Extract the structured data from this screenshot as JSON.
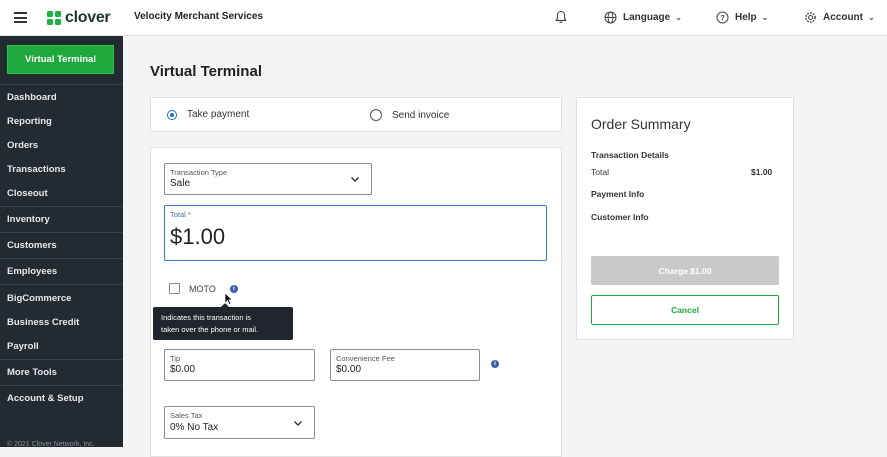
{
  "header": {
    "logo_text": "clover",
    "merchant_name": "Velocity Merchant Services",
    "language_label": "Language",
    "help_label": "Help",
    "account_label": "Account",
    "brand_color": "#1fa83c"
  },
  "sidebar": {
    "primary_button": "Virtual Terminal",
    "items": [
      {
        "label": "Dashboard"
      },
      {
        "label": "Reporting"
      },
      {
        "label": "Orders"
      },
      {
        "label": "Transactions"
      },
      {
        "label": "Closeout"
      },
      {
        "label": "Inventory"
      },
      {
        "label": "Customers"
      },
      {
        "label": "Employees"
      },
      {
        "label": "BigCommerce"
      },
      {
        "label": "Business Credit"
      },
      {
        "label": "Payroll"
      },
      {
        "label": "More Tools"
      },
      {
        "label": "Account & Setup"
      }
    ],
    "copyright": "© 2021 Clover Network, Inc."
  },
  "main": {
    "page_title": "Virtual Terminal",
    "payment_mode": {
      "take_payment": "Take payment",
      "send_invoice": "Send invoice",
      "selected": "Take payment"
    },
    "form": {
      "transaction_type": {
        "label": "Transaction Type",
        "value": "Sale"
      },
      "total": {
        "label": "Total *",
        "value": "$1.00"
      },
      "moto_label": "MOTO",
      "moto_checked": false,
      "moto_tooltip_line1": "Indicates this transaction is",
      "moto_tooltip_line2": "taken over the phone or mail.",
      "tip": {
        "label": "Tip",
        "value": "$0.00"
      },
      "convenience_fee": {
        "label": "Convenience Fee",
        "value": "$0.00"
      },
      "sales_tax": {
        "label": "Sales Tax",
        "value": "0% No Tax"
      }
    }
  },
  "order_summary": {
    "title": "Order Summary",
    "transaction_details": "Transaction Details",
    "total_label": "Total",
    "total_value": "$1.00",
    "payment_info": "Payment Info",
    "customer_info": "Customer Info",
    "charge_button": "Charge $1.00",
    "cancel_button": "Cancel"
  }
}
